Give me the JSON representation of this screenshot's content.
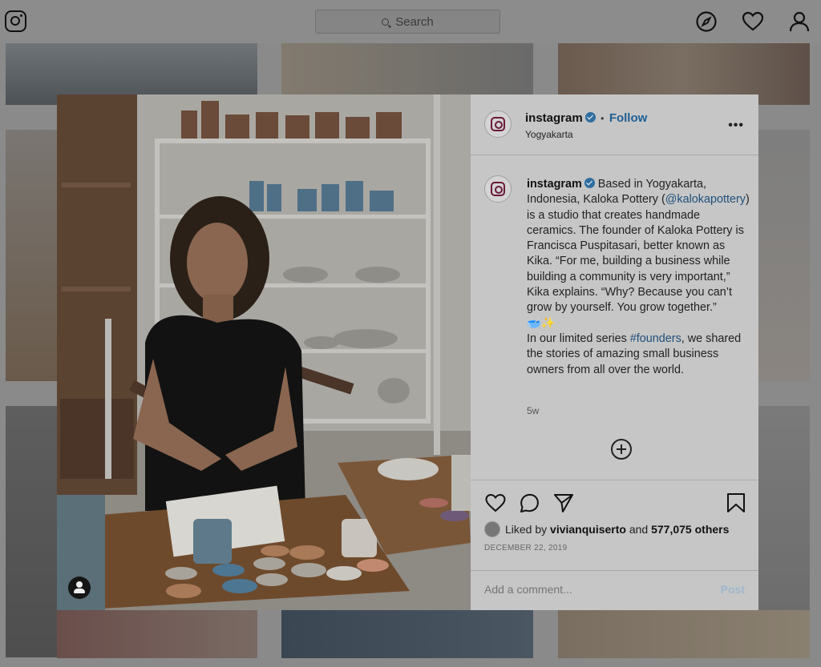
{
  "nav": {
    "search_placeholder": "Search",
    "icons": [
      "instagram-logo-icon",
      "search-icon",
      "explore-compass-icon",
      "activity-heart-icon",
      "profile-icon"
    ]
  },
  "post": {
    "header": {
      "username": "instagram",
      "verified": true,
      "separator": "•",
      "follow_label": "Follow",
      "location": "Yogyakarta",
      "more_label": "•••"
    },
    "caption": {
      "username": "instagram",
      "text_1": "Based in Yogyakarta, Indonesia, Kaloka Pottery (",
      "mention": "@kalokapottery",
      "text_2": ") is a studio that creates handmade ceramics. The founder of Kaloka Pottery is Francisca Puspitasari, better known as Kika. “For me, building a business while building a community is very important,” Kika explains. “Why? Because you can’t grow by yourself. You grow together.”",
      "emoji": "🥣✨",
      "text_3": "In our limited series ",
      "hashtag": "#founders",
      "text_4": ", we shared the stories of amazing small business owners from all over the world.",
      "age": "5w"
    },
    "likes": {
      "prefix": "Liked by",
      "liked_user": "vivianquiserto",
      "and": "and",
      "count_text": "577,075 others"
    },
    "date": "DECEMBER 22, 2019",
    "comment_placeholder": "Add a comment...",
    "post_label": "Post"
  },
  "colors": {
    "link_blue": "#1f5f93",
    "verified_blue": "#2f6ea0",
    "overlay": "#8a8a8a"
  }
}
